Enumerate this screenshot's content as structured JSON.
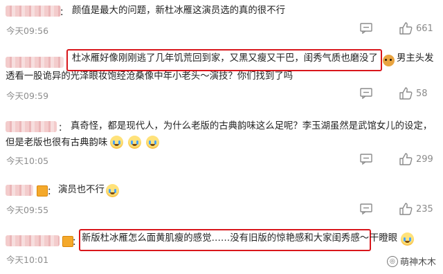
{
  "comments": [
    {
      "colon": "：",
      "text_lines": [
        "颜值是最大的问题，新杜冰雁这演员选的真的很不行"
      ],
      "time": "今天09:56",
      "likes": "661",
      "comment_icon": "comment-icon",
      "like_icon": "thumbs-up-icon"
    },
    {
      "colon": "",
      "boxed_text": "杜冰雁好像刚刚逃了几年饥荒回到家，又黑又瘦又干巴，闺秀气质也磨没了",
      "line1_tail": "男主头发",
      "line2": "透看一股诡异的光泽眼妆饱经沧桑像中年小老头～演技？你们找到了吗",
      "time": "今天09:59",
      "likes": "58"
    },
    {
      "colon": "：",
      "text_lines": [
        "真奇怪，都是现代人，为什么老版的古典韵味这么足呢？李玉湖虽然是武馆女儿的设定，",
        "但是老版也很有古典韵味"
      ],
      "time": "今天10:05",
      "likes": "299"
    },
    {
      "colon": "：",
      "text_lines": [
        "演员也不行"
      ],
      "time": "今天09:55",
      "likes": "235"
    },
    {
      "colon": "：",
      "boxed_text": "新版杜冰雁怎么面黄肌瘦的感觉……没有旧版的惊艳感和大家闺秀感～",
      "tail": "干瞪眼",
      "time": "今天10:01"
    }
  ],
  "watermark": "萌神木木",
  "colors": {
    "highlight_box": "#d9161b",
    "time": "#8d8d8d",
    "text": "#222222"
  }
}
